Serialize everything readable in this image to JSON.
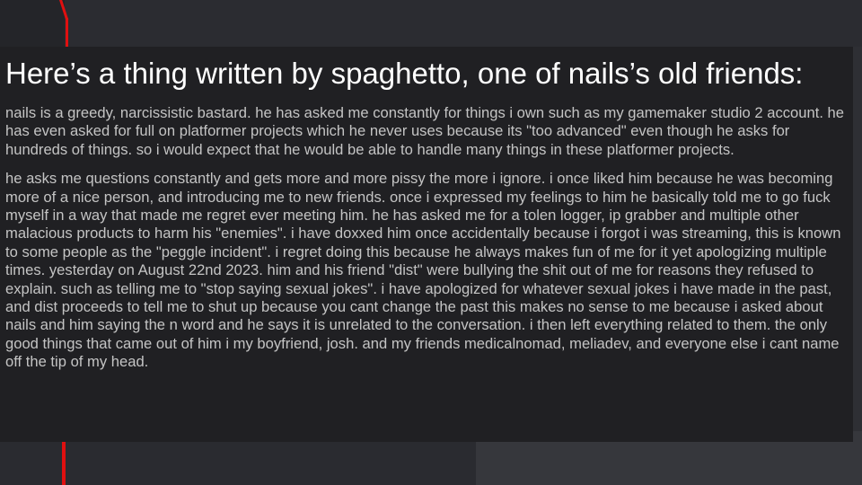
{
  "title": "Here’s a thing written by spaghetto, one of nails’s old friends:",
  "paragraphs": [
    "nails is a greedy, narcissistic bastard. he has asked me constantly for things i own such as my gamemaker studio 2 account. he has even asked for full on platformer projects which he never uses because its \"too advanced\" even though he asks for hundreds of things. so i would expect that he would be able to handle many things in these platformer projects.",
    "he asks me questions constantly and gets more and more pissy the more i ignore. i once liked him because he was becoming more of a nice person, and introducing me to new friends. once i expressed my feelings to him he basically told me to go fuck myself in a way that made me regret ever meeting him. he has asked me for a tolen logger, ip grabber and multiple other malacious products to harm his \"enemies\". i have doxxed him once accidentally because i forgot i was streaming, this is known to some people as the \"peggle incident\". i regret doing this because he always makes fun of me for it yet apologizing multiple times. yesterday on August 22nd 2023. him and his friend \"dist\" were bullying the shit out of me for reasons they refused to explain. such as telling me to \"stop saying sexual jokes\". i have apologized for whatever sexual jokes i have made in the past, and dist proceeds to tell me to shut up because you cant change the past this makes no sense to me because i asked about nails and him saying the n word and he says it is unrelated to the conversation. i then left everything related to them. the only good things that came out of him i my boyfriend, josh. and my friends medicalnomad, meliadev, and everyone else i cant name off the tip of my head."
  ],
  "colors": {
    "panel_background": "#202023",
    "page_background": "#2e2f34",
    "title_text": "#ffffff",
    "body_text": "#c4c4c4",
    "accent_red": "#e01010"
  }
}
